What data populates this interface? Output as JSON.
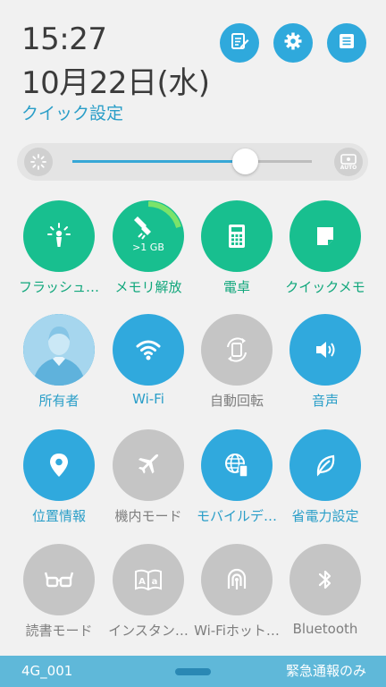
{
  "header": {
    "time": "15:27",
    "date": "10月22日(水)",
    "quick_settings_label": "クイック設定",
    "buttons": [
      {
        "name": "edit-icon"
      },
      {
        "name": "gear-icon"
      },
      {
        "name": "notification-list-icon"
      }
    ]
  },
  "brightness": {
    "level_percent": 72,
    "auto_label": "AUTO",
    "icon_left": "brightness-low-icon",
    "icon_right": "brightness-auto-icon"
  },
  "tiles": [
    {
      "label": "フラッシュ…",
      "icon": "flashlight-icon",
      "state": "on",
      "color": "#18bf8f"
    },
    {
      "label": "メモリ解放",
      "icon": "memory-boost-icon",
      "state": "on",
      "color": "#18bf8f",
      "badge": ">1 GB"
    },
    {
      "label": "電卓",
      "icon": "calculator-icon",
      "state": "on",
      "color": "#18bf8f"
    },
    {
      "label": "クイックメモ",
      "icon": "quick-memo-icon",
      "state": "on",
      "color": "#18bf8f"
    },
    {
      "label": "所有者",
      "icon": "avatar-icon",
      "state": "on",
      "color": "#30a9dd"
    },
    {
      "label": "Wi-Fi",
      "icon": "wifi-icon",
      "state": "on",
      "color": "#30a9dd"
    },
    {
      "label": "自動回転",
      "icon": "auto-rotate-icon",
      "state": "off",
      "color": "#c5c5c5"
    },
    {
      "label": "音声",
      "icon": "sound-icon",
      "state": "on",
      "color": "#30a9dd"
    },
    {
      "label": "位置情報",
      "icon": "location-icon",
      "state": "on",
      "color": "#30a9dd"
    },
    {
      "label": "機内モード",
      "icon": "airplane-icon",
      "state": "off",
      "color": "#c5c5c5"
    },
    {
      "label": "モバイルデ…",
      "icon": "mobile-data-icon",
      "state": "on",
      "color": "#30a9dd"
    },
    {
      "label": "省電力設定",
      "icon": "power-saving-leaf-icon",
      "state": "on",
      "color": "#30a9dd"
    },
    {
      "label": "読書モード",
      "icon": "reading-glasses-icon",
      "state": "off",
      "color": "#c5c5c5"
    },
    {
      "label": "インスタン…",
      "icon": "instant-dictionary-icon",
      "state": "off",
      "color": "#c5c5c5"
    },
    {
      "label": "Wi-Fiホット…",
      "icon": "wifi-hotspot-icon",
      "state": "off",
      "color": "#c5c5c5"
    },
    {
      "label": "Bluetooth",
      "icon": "bluetooth-icon",
      "state": "off",
      "color": "#c5c5c5"
    }
  ],
  "footer": {
    "carrier": "4G_001",
    "emergency": "緊急通報のみ"
  }
}
